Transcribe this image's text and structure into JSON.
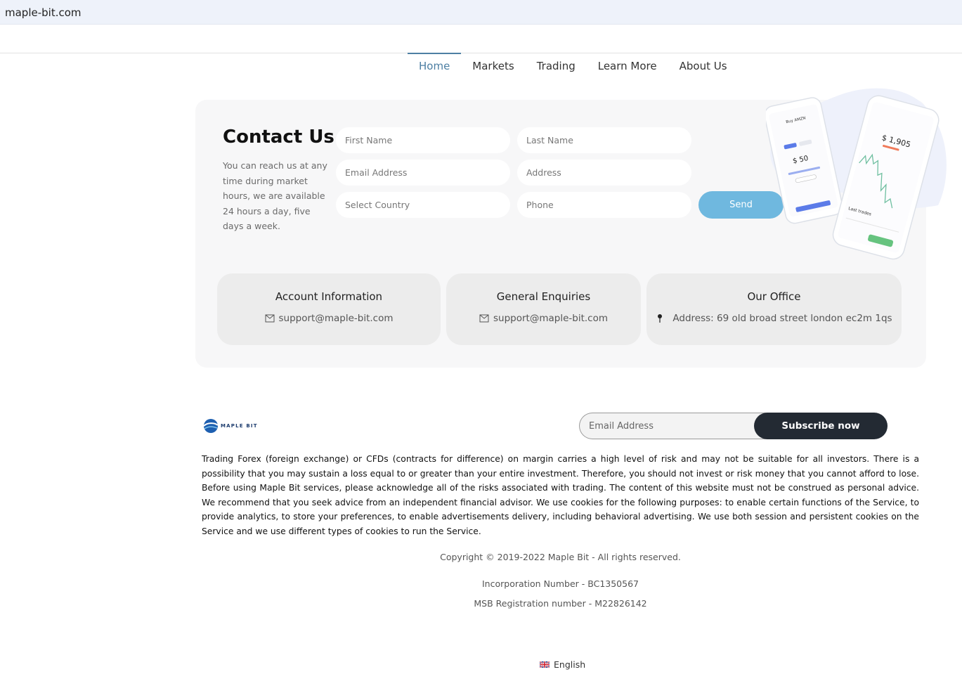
{
  "browser": {
    "url": "maple-bit.com"
  },
  "nav": {
    "items": [
      "Home",
      "Markets",
      "Trading",
      "Learn More",
      "About Us"
    ],
    "active": "Home"
  },
  "contact": {
    "title": "Contact Us",
    "description": "You can reach us at any time during market hours, we are available 24 hours a day, five days a week.",
    "fields": {
      "first_name": "First Name",
      "last_name": "Last Name",
      "email": "Email Address",
      "address": "Address",
      "country": "Select Country",
      "phone": "Phone"
    },
    "send_label": "Send"
  },
  "phone_mockup": {
    "small_screen": {
      "title": "Buy AMZN",
      "amount": "$ 50"
    },
    "large_screen": {
      "price": "$ 1,905",
      "section": "Last trades"
    }
  },
  "info_cards": [
    {
      "title": "Account Information",
      "value": "support@maple-bit.com",
      "icon": "mail-icon"
    },
    {
      "title": "General Enquiries",
      "value": "support@maple-bit.com",
      "icon": "mail-icon"
    },
    {
      "title": "Our Office",
      "value": "Address: 69 old broad street london ec2m 1qs",
      "icon": "location-pin-icon"
    }
  ],
  "footer": {
    "logo_text": "MAPLE BIT",
    "subscribe": {
      "placeholder": "Email Address",
      "button": "Subscribe now"
    },
    "disclaimer": "Trading Forex (foreign exchange) or CFDs (contracts for difference) on margin carries a high level of risk and may not be suitable for all investors. There is a possibility that you may sustain a loss equal to or greater than your entire investment. Therefore, you should not invest or risk money that you cannot afford to lose. Before using Maple Bit services, please acknowledge all of the risks associated with trading. The content of this website must not be construed as personal advice. We recommend that you seek advice from an independent financial advisor. We use cookies for the following purposes: to enable certain functions of the Service, to provide analytics, to store your preferences, to enable advertisements delivery, including behavioral advertising. We use both session and persistent cookies on the Service and we use different types of cookies to run the Service.",
    "copyright": "Copyright © 2019-2022 Maple Bit - All rights reserved.",
    "incorporation": "Incorporation Number - BC1350567",
    "msb": "MSB Registration number - M22826142",
    "language": "English"
  },
  "colors": {
    "accent": "#4d7fa3",
    "send_button": "#6fb8df",
    "subscribe_button": "#232a33",
    "card_background": "#f7f7f8"
  }
}
